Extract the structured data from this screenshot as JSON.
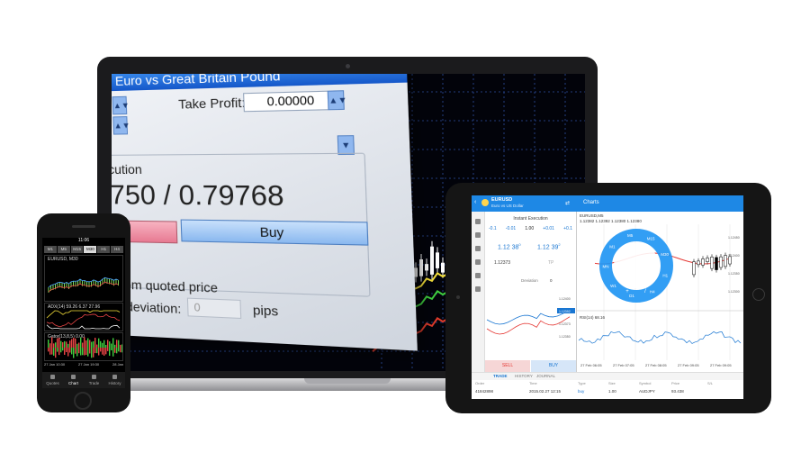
{
  "laptop": {
    "dialog": {
      "title": "Euro vs Great Britain Pound",
      "take_profit_label": "Take Profit:",
      "take_profit_value": "0.00000",
      "execution_label": "xecution",
      "price": "750 / 0.79768",
      "buy_label": "Buy",
      "deviation_line1": "n from quoted price",
      "deviation_line2": "um deviation:",
      "deviation_value": "0",
      "pips_label": "pips"
    },
    "colors": {
      "candle": "#ffffff",
      "ma_yellow": "#f5e03a",
      "ma_green": "#3fcf3f",
      "ma_red": "#e23b2b",
      "grid": "#2d4fa0"
    }
  },
  "phone": {
    "time": "11:06",
    "timeframes": [
      "M1",
      "M5",
      "M15",
      "M30",
      "H1",
      "H4"
    ],
    "active_timeframe": "M30",
    "chart_title": "EURUSD, M30",
    "indicator1": "ADX(14) 59.26 6.37 27.96",
    "indicator2": "Gator(13,8,5) 0.00",
    "dates": [
      "27 Jan 10:30",
      "27 Jan 19:30",
      "28 Jan"
    ],
    "nav": [
      "Quotes",
      "Chart",
      "Trade",
      "History"
    ],
    "active_nav": "Chart"
  },
  "tablet": {
    "symbol": "EURUSD",
    "symbol_desc": "Euro vs US Dollar",
    "screen_title": "Charts",
    "execution_title": "Instant Execution",
    "steps": [
      "-0.1",
      "-0.01",
      "1.00",
      "+0.01",
      "+0.1"
    ],
    "bid": "1.12 38",
    "ask": "1.12 39",
    "bid_sup": "0",
    "ask_sup": "2",
    "sl_value": "1.12373",
    "tp_label": "TP",
    "deviation_label": "Deviation",
    "deviation_value": "0",
    "sell_label": "SELL",
    "buy_label": "BUY",
    "mini_prices": [
      "1.12400",
      "1.12392",
      "1.12373",
      "1.12350"
    ],
    "chart_title": "EURUSD,M5",
    "chart_ohlc": "1.12382 1.12392 1.12380 1.12380",
    "wheel_timeframes": [
      "M1",
      "M5",
      "M15",
      "M30",
      "H1",
      "H4",
      "D1",
      "W1",
      "MN"
    ],
    "rsi_label": "RSI(14) 68.16",
    "x_labels": [
      "27 Feb 06:05",
      "27 Feb 07:05",
      "27 Feb 08:05",
      "27 Feb 09:05",
      "27 Feb 09:05"
    ],
    "price_scale": [
      "1.12450",
      "1.12400",
      "1.12350",
      "1.12300"
    ],
    "tabs": [
      "TRADE",
      "HISTORY",
      "JOURNAL"
    ],
    "active_tab": "TRADE",
    "table_headers": [
      "Order",
      "Time",
      "Type",
      "Size",
      "Symbol",
      "Price",
      "S/L"
    ],
    "table_row": [
      "41842898",
      "2015.02.27 12:15",
      "buy",
      "1.00",
      "AUDJPY",
      "93.438",
      ""
    ]
  }
}
